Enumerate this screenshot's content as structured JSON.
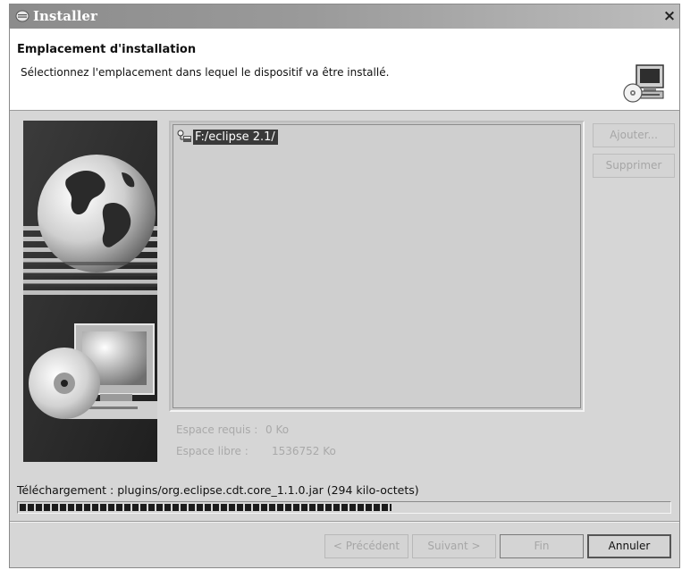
{
  "window": {
    "title": "Installer",
    "close_label": "×"
  },
  "header": {
    "title": "Emplacement d'installation",
    "subtitle": "Sélectionnez l'emplacement dans lequel le dispositif va être installé."
  },
  "locations": {
    "items": [
      {
        "label": "F:/eclipse 2.1/",
        "selected": true
      }
    ]
  },
  "side_buttons": {
    "add_label": "Ajouter...",
    "remove_label": "Supprimer"
  },
  "space": {
    "required_label": "Espace requis :",
    "required_value": "0 Ko",
    "free_label": "Espace libre :",
    "free_value": "1536752 Ko"
  },
  "download": {
    "text": "Téléchargement : plugins/org.eclipse.cdt.core_1.1.0.jar (294 kilo-octets)",
    "progress": 0.57
  },
  "footer": {
    "previous_label": "< Précédent",
    "next_label": "Suivant >",
    "finish_label": "Fin",
    "cancel_label": "Annuler"
  },
  "icons": {
    "title": "eclipse-icon",
    "header": "computer-cd-icon",
    "row": "folder-tree-icon"
  },
  "colors": {
    "selection": "#3a3a3a",
    "dialog_bg": "#d6d6d6",
    "disabled_text": "#a6a6a6"
  }
}
